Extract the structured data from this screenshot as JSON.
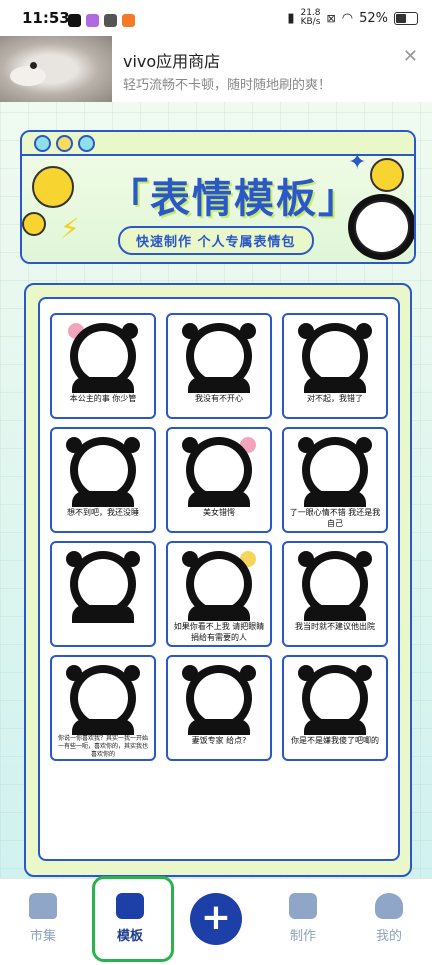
{
  "status_bar": {
    "time": "11:53",
    "net_speed_value": "21.8",
    "net_speed_unit": "KB/s",
    "battery": "52%"
  },
  "notification": {
    "title": "vivo应用商店",
    "subtitle": "轻巧流畅不卡顿，随时随地刷的爽！"
  },
  "banner": {
    "title": "「表情模板」",
    "subtitle": "快速制作 个人专属表情包"
  },
  "templates": [
    {
      "caption": "本公主的事  你少管"
    },
    {
      "caption": "我没有不开心"
    },
    {
      "caption": "对不起，我错了"
    },
    {
      "caption": "想不到吧，我还没睡"
    },
    {
      "caption": "美女错愕"
    },
    {
      "caption": "了一眼心情不错  我还是我自己"
    },
    {
      "caption": ""
    },
    {
      "caption": "如果你看不上我 请把眼睛捐给有需要的人"
    },
    {
      "caption": "我当时就不建议他出院"
    },
    {
      "caption": "你说一你喜欢我？其实一我一开始一有些一呃，喜欢你的，其实我也喜欢你的"
    },
    {
      "caption": "妻饭专家  给点?"
    },
    {
      "caption": "你是不是嫌我傻了吧唧的"
    }
  ],
  "tabs": [
    {
      "label": "市集",
      "icon": "home-icon"
    },
    {
      "label": "模板",
      "icon": "template-icon"
    },
    {
      "label": "",
      "icon": "plus-icon"
    },
    {
      "label": "制作",
      "icon": "edit-icon"
    },
    {
      "label": "我的",
      "icon": "profile-icon"
    }
  ],
  "colors": {
    "accent": "#2a57c9",
    "plus_button": "#1c3fa8",
    "highlight": "#2bb24c",
    "lime": "#eaf7c9"
  }
}
